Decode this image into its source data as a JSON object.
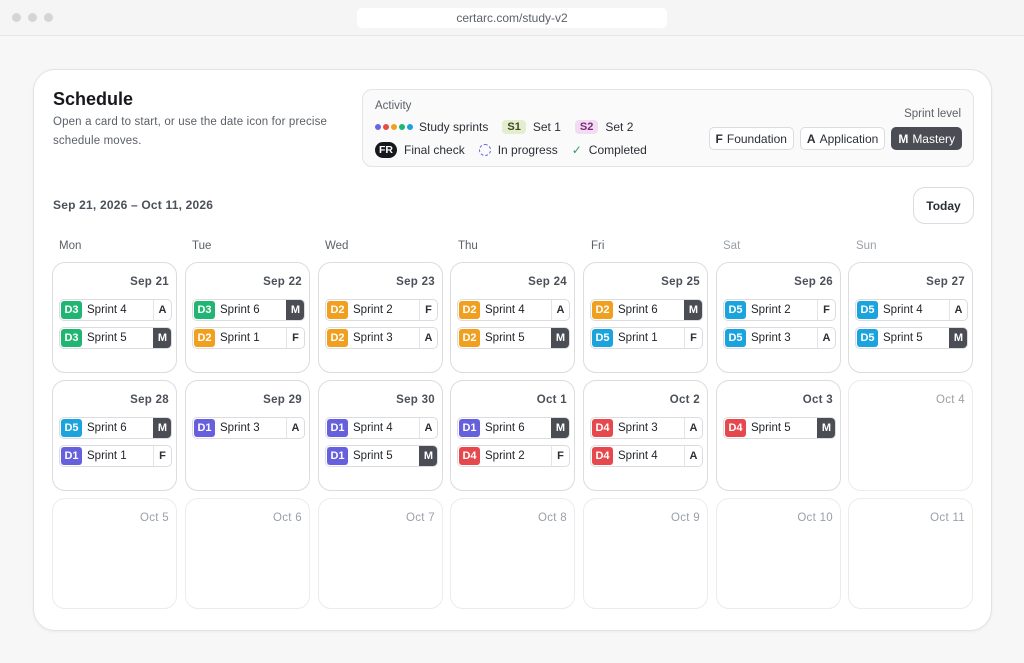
{
  "browser": {
    "url": "certarc.com/study-v2"
  },
  "header": {
    "title": "Schedule",
    "subtitle": "Open a card to start, or use the date icon for precise schedule moves."
  },
  "legend": {
    "heading": "Activity",
    "study_sprints": "Study sprints",
    "set1_tag": "S1",
    "set1_label": "Set 1",
    "set2_tag": "S2",
    "set2_label": "Set 2",
    "final_tag": "FR",
    "final_label": "Final check",
    "in_progress": "In progress",
    "completed": "Completed",
    "sprint_level_heading": "Sprint level",
    "levels": [
      {
        "key": "F",
        "label": "Foundation"
      },
      {
        "key": "A",
        "label": "Application"
      },
      {
        "key": "M",
        "label": "Mastery"
      }
    ],
    "dot_colors": [
      "#6b66e0",
      "#e84a4a",
      "#f0a01e",
      "#21b573",
      "#1aa3dd"
    ]
  },
  "date_range": "Sep 21, 2026 – Oct 11, 2026",
  "today_label": "Today",
  "weekdays": [
    "Mon",
    "Tue",
    "Wed",
    "Thu",
    "Fri",
    "Sat",
    "Sun"
  ],
  "domain_colors": {
    "D1": "#6660dc",
    "D2": "#f0a01e",
    "D3": "#21b573",
    "D4": "#e5484d",
    "D5": "#1aa3dd"
  },
  "weeks": [
    [
      {
        "date": "Sep 21",
        "items": [
          {
            "d": "D3",
            "name": "Sprint 4",
            "lvl": "A"
          },
          {
            "d": "D3",
            "name": "Sprint 5",
            "lvl": "M"
          }
        ]
      },
      {
        "date": "Sep 22",
        "items": [
          {
            "d": "D3",
            "name": "Sprint 6",
            "lvl": "M"
          },
          {
            "d": "D2",
            "name": "Sprint 1",
            "lvl": "F"
          }
        ]
      },
      {
        "date": "Sep 23",
        "items": [
          {
            "d": "D2",
            "name": "Sprint 2",
            "lvl": "F"
          },
          {
            "d": "D2",
            "name": "Sprint 3",
            "lvl": "A"
          }
        ]
      },
      {
        "date": "Sep 24",
        "items": [
          {
            "d": "D2",
            "name": "Sprint 4",
            "lvl": "A"
          },
          {
            "d": "D2",
            "name": "Sprint 5",
            "lvl": "M"
          }
        ]
      },
      {
        "date": "Sep 25",
        "items": [
          {
            "d": "D2",
            "name": "Sprint 6",
            "lvl": "M"
          },
          {
            "d": "D5",
            "name": "Sprint 1",
            "lvl": "F"
          }
        ]
      },
      {
        "date": "Sep 26",
        "items": [
          {
            "d": "D5",
            "name": "Sprint 2",
            "lvl": "F"
          },
          {
            "d": "D5",
            "name": "Sprint 3",
            "lvl": "A"
          }
        ]
      },
      {
        "date": "Sep 27",
        "items": [
          {
            "d": "D5",
            "name": "Sprint 4",
            "lvl": "A"
          },
          {
            "d": "D5",
            "name": "Sprint 5",
            "lvl": "M"
          }
        ]
      }
    ],
    [
      {
        "date": "Sep 28",
        "items": [
          {
            "d": "D5",
            "name": "Sprint 6",
            "lvl": "M"
          },
          {
            "d": "D1",
            "name": "Sprint 1",
            "lvl": "F"
          }
        ]
      },
      {
        "date": "Sep 29",
        "items": [
          {
            "d": "D1",
            "name": "Sprint 3",
            "lvl": "A"
          }
        ]
      },
      {
        "date": "Sep 30",
        "items": [
          {
            "d": "D1",
            "name": "Sprint 4",
            "lvl": "A"
          },
          {
            "d": "D1",
            "name": "Sprint 5",
            "lvl": "M"
          }
        ]
      },
      {
        "date": "Oct 1",
        "items": [
          {
            "d": "D1",
            "name": "Sprint 6",
            "lvl": "M"
          },
          {
            "d": "D4",
            "name": "Sprint 2",
            "lvl": "F"
          }
        ]
      },
      {
        "date": "Oct 2",
        "items": [
          {
            "d": "D4",
            "name": "Sprint 3",
            "lvl": "A"
          },
          {
            "d": "D4",
            "name": "Sprint 4",
            "lvl": "A"
          }
        ]
      },
      {
        "date": "Oct 3",
        "items": [
          {
            "d": "D4",
            "name": "Sprint 5",
            "lvl": "M"
          }
        ]
      },
      {
        "date": "Oct 4",
        "items": [],
        "future": true
      }
    ],
    [
      {
        "date": "Oct 5",
        "items": [],
        "future": true
      },
      {
        "date": "Oct 6",
        "items": [],
        "future": true
      },
      {
        "date": "Oct 7",
        "items": [],
        "future": true
      },
      {
        "date": "Oct 8",
        "items": [],
        "future": true
      },
      {
        "date": "Oct 9",
        "items": [],
        "future": true
      },
      {
        "date": "Oct 10",
        "items": [],
        "future": true
      },
      {
        "date": "Oct 11",
        "items": [],
        "future": true
      }
    ]
  ]
}
